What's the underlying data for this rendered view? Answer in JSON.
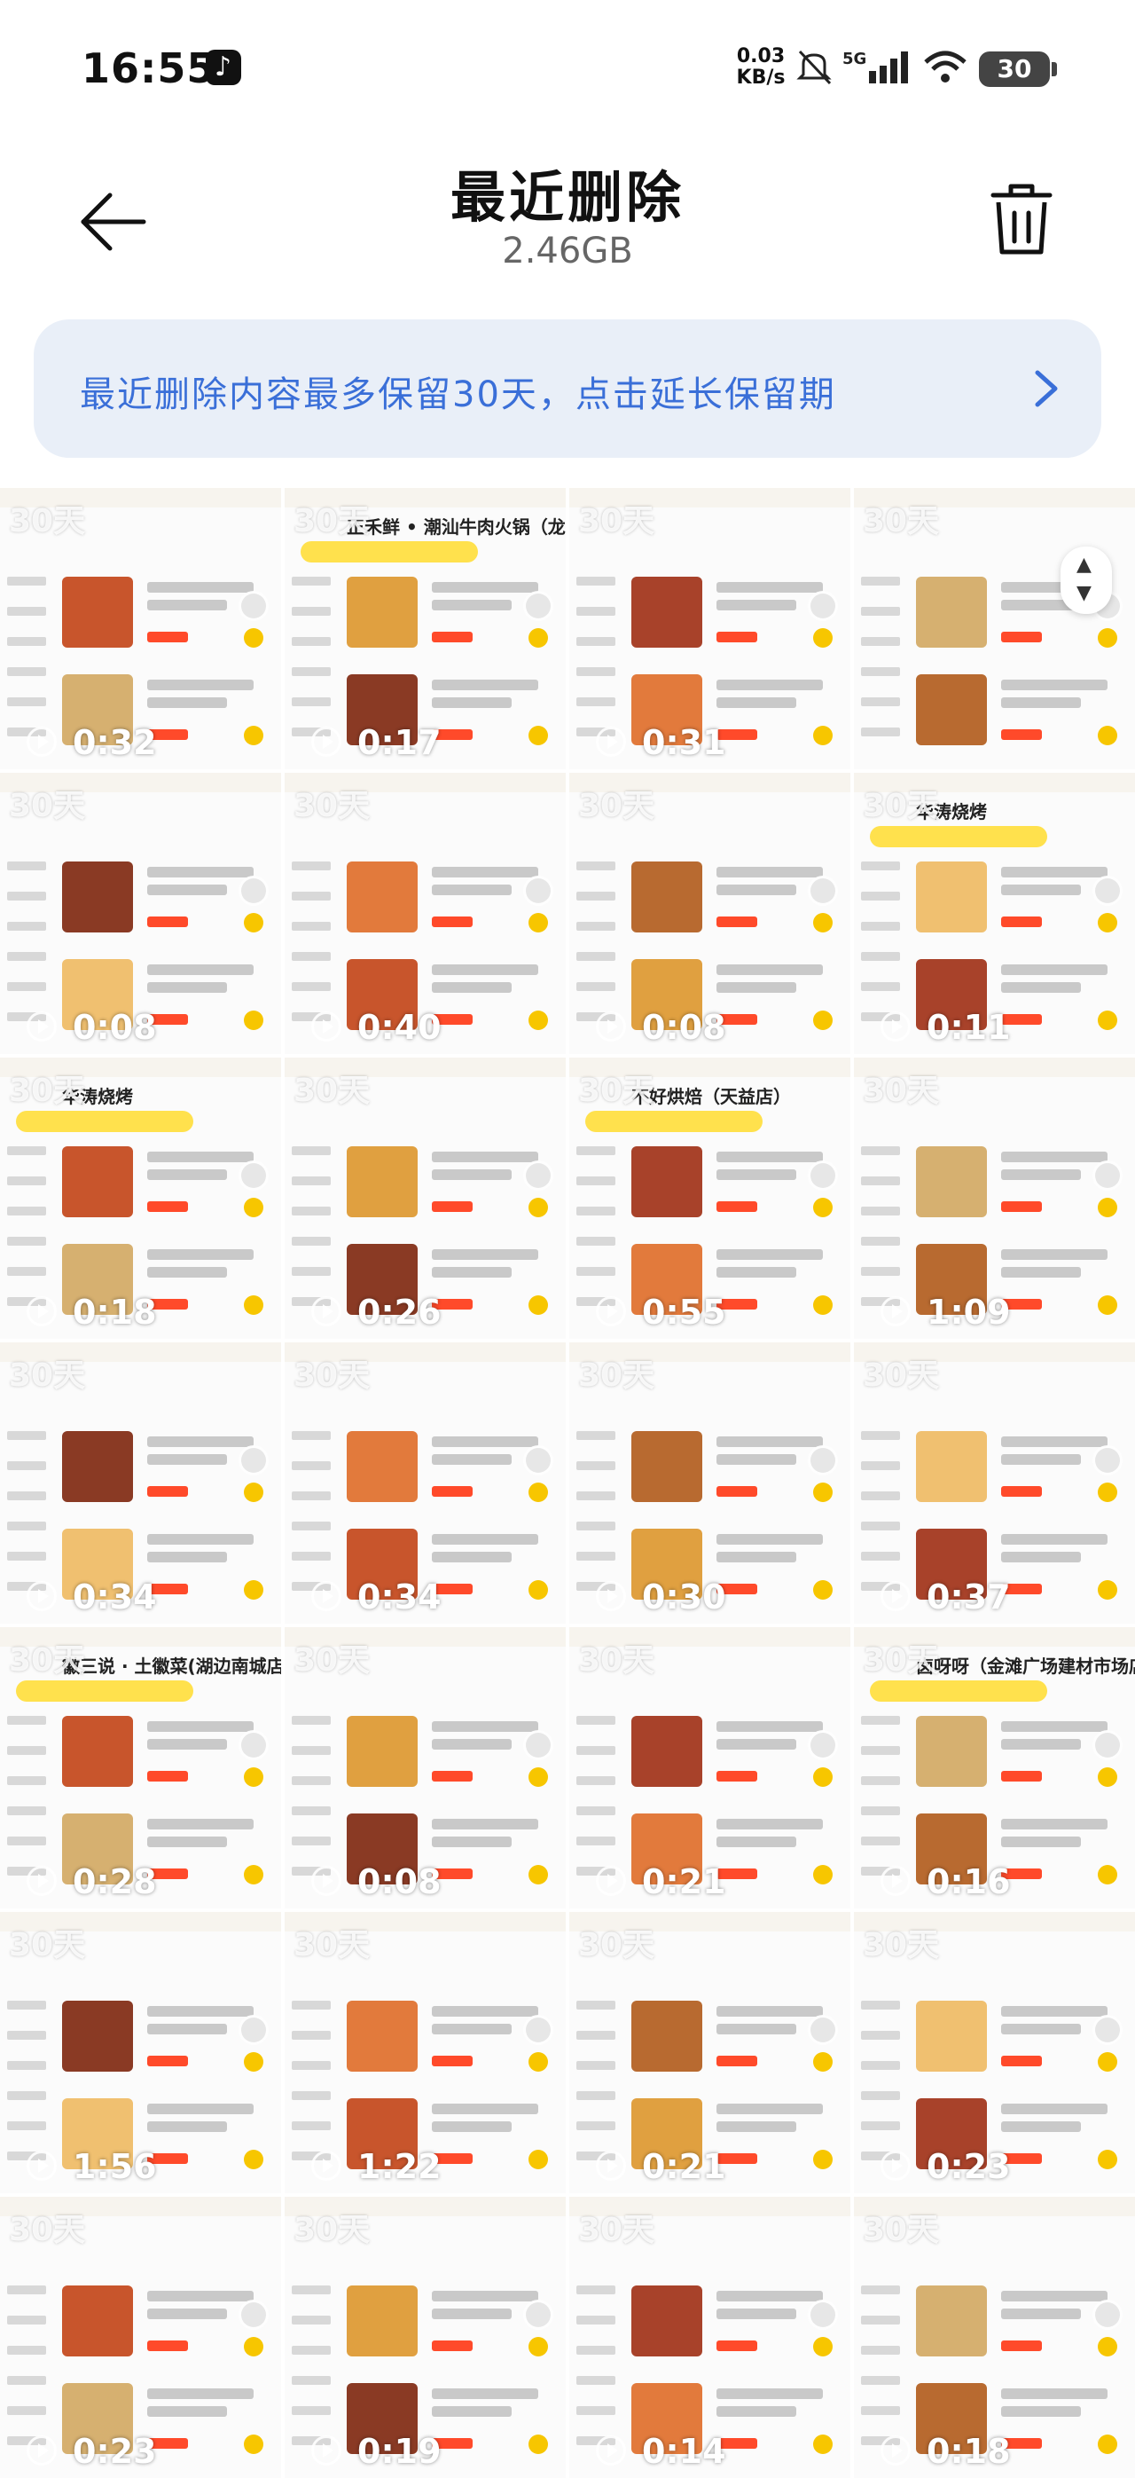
{
  "status_bar": {
    "time": "16:55",
    "net_speed_value": "0.03",
    "net_speed_unit": "KB/s",
    "signal_label": "5G",
    "battery": "30"
  },
  "header": {
    "title": "最近删除",
    "size": "2.46GB"
  },
  "notice": {
    "text": "最近删除内容最多保留30天，点击延长保留期"
  },
  "badge_label": "30天",
  "thumbnails": [
    {
      "duration": "0:32",
      "store": ""
    },
    {
      "duration": "0:17",
      "store": "正禾鲜 • 潮汕牛肉火锅（龙湖时代"
    },
    {
      "duration": "0:31",
      "store": ""
    },
    {
      "duration": "",
      "store": ""
    },
    {
      "duration": "0:08",
      "store": ""
    },
    {
      "duration": "0:40",
      "store": ""
    },
    {
      "duration": "0:08",
      "store": ""
    },
    {
      "duration": "0:11",
      "store": "华涛烧烤"
    },
    {
      "duration": "0:18",
      "store": "华涛烧烤"
    },
    {
      "duration": "0:26",
      "store": ""
    },
    {
      "duration": "0:55",
      "store": "不好烘焙（天益店）"
    },
    {
      "duration": "1:09",
      "store": ""
    },
    {
      "duration": "0:34",
      "store": ""
    },
    {
      "duration": "0:34",
      "store": ""
    },
    {
      "duration": "0:30",
      "store": ""
    },
    {
      "duration": "0:37",
      "store": ""
    },
    {
      "duration": "0:28",
      "store": "徽三说 · 土徽菜(湖边南城店)"
    },
    {
      "duration": "0:08",
      "store": ""
    },
    {
      "duration": "0:21",
      "store": ""
    },
    {
      "duration": "0:16",
      "store": "卤呀呀（金滩广场建材市场店）"
    },
    {
      "duration": "1:56",
      "store": ""
    },
    {
      "duration": "1:22",
      "store": ""
    },
    {
      "duration": "0:21",
      "store": ""
    },
    {
      "duration": "0:23",
      "store": ""
    },
    {
      "duration": "0:23",
      "store": ""
    },
    {
      "duration": "0:19",
      "store": ""
    },
    {
      "duration": "0:14",
      "store": ""
    },
    {
      "duration": "0:18",
      "store": ""
    }
  ],
  "colors": {
    "accent": "#3a6fd8",
    "notice_bg": "#e9eff8",
    "price": "#ff4a2a",
    "yellow": "#f7c600"
  }
}
